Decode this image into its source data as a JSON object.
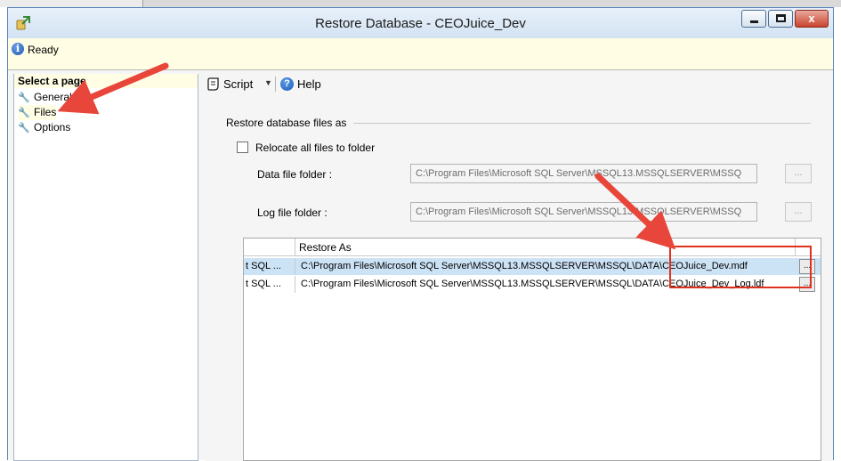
{
  "window": {
    "title": "Restore Database - CEOJuice_Dev",
    "close_glyph": "x"
  },
  "status": {
    "text": "Ready",
    "icon": "info-icon"
  },
  "sidebar": {
    "heading": "Select a page",
    "items": [
      {
        "label": "General",
        "icon": "wrench-icon",
        "selected": false
      },
      {
        "label": "Files",
        "icon": "wrench-icon",
        "selected": true
      },
      {
        "label": "Options",
        "icon": "wrench-icon",
        "selected": false
      }
    ]
  },
  "toolbar": {
    "script_label": "Script",
    "help_label": "Help"
  },
  "files_page": {
    "group_title": "Restore database files as",
    "relocate_label": "Relocate all files to folder",
    "relocate_checked": false,
    "data_folder_label": "Data file folder :",
    "data_folder_value": "C:\\Program Files\\Microsoft SQL Server\\MSSQL13.MSSQLSERVER\\MSSQ",
    "log_folder_label": "Log file folder :",
    "log_folder_value": "C:\\Program Files\\Microsoft SQL Server\\MSSQL13.MSSQLSERVER\\MSSQ",
    "browse_label": "...",
    "grid": {
      "columns": [
        "",
        "Restore As"
      ],
      "rows": [
        {
          "original": "t SQL ...",
          "restore_as": "C:\\Program Files\\Microsoft SQL Server\\MSSQL13.MSSQLSERVER\\MSSQL\\DATA\\CEOJuice_Dev.mdf",
          "selected": true
        },
        {
          "original": "t SQL ...",
          "restore_as": "C:\\Program Files\\Microsoft SQL Server\\MSSQL13.MSSQLSERVER\\MSSQL\\DATA\\CEOJuice_Dev_Log.ldf",
          "selected": false
        }
      ],
      "row_button": "..."
    }
  },
  "colors": {
    "annotation": "#e0301e",
    "selection": "#cce2f5",
    "status_bg": "#fffde4"
  }
}
